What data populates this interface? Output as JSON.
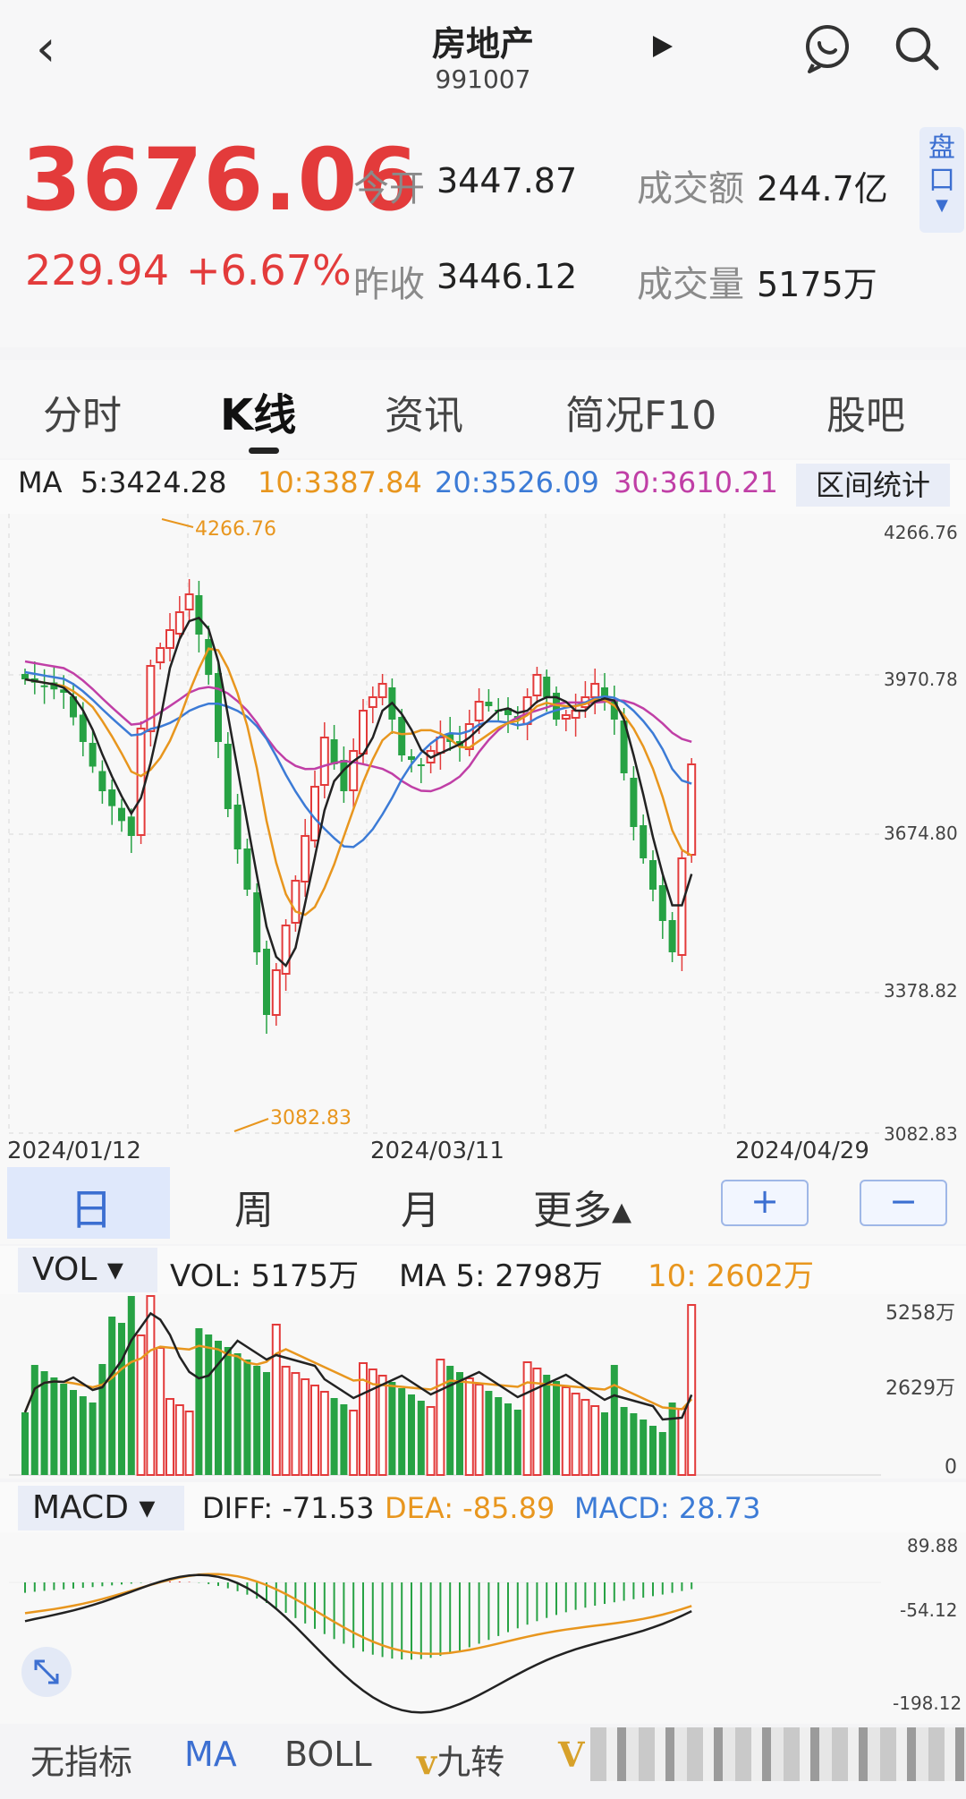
{
  "header": {
    "title": "房地产",
    "code": "991007"
  },
  "quote": {
    "price": "3676.06",
    "change": "229.94",
    "change_pct": "+6.67%",
    "open_label": "今开",
    "open": "3447.87",
    "prev_close_label": "昨收",
    "prev_close": "3446.12",
    "amount_label": "成交额",
    "amount": "244.7亿",
    "volume_label": "成交量",
    "volume": "5175万",
    "pankou": "盘口"
  },
  "tabs": [
    "分时",
    "K线",
    "资讯",
    "简况F10",
    "股吧"
  ],
  "ma_legend": {
    "prefix": "MA",
    "ma5": "5:3424.28",
    "ma10": "10:3387.84",
    "ma20": "20:3526.09",
    "ma30": "30:3610.21",
    "range_button": "区间统计"
  },
  "kline": {
    "axis": [
      "4266.76",
      "3970.78",
      "3674.80",
      "3378.82",
      "3082.83"
    ],
    "dates": [
      "2024/01/12",
      "2024/03/11",
      "2024/04/29"
    ],
    "high_marker": "4266.76",
    "low_marker": "3082.83"
  },
  "period": {
    "day": "日",
    "week": "周",
    "month": "月",
    "more": "更多▴",
    "zoom_in": "+",
    "zoom_out": "−"
  },
  "vol": {
    "selector": "VOL ▾",
    "vol": "VOL:  5175万",
    "ma5": "MA 5:  2798万",
    "ma10": "10:  2602万",
    "axis": [
      "5258万",
      "2629万",
      "0"
    ]
  },
  "macd": {
    "selector": "MACD ▾",
    "diff": "DIFF: -71.53",
    "dea": "DEA: -85.89",
    "macd": "MACD: 28.73",
    "axis": [
      "89.88",
      "-54.12",
      "-198.12"
    ]
  },
  "bottom_tabs": [
    "无指标",
    "MA",
    "BOLL",
    "九转",
    "V"
  ],
  "colors": {
    "up": "#e33b3b",
    "down": "#27a244",
    "ma5": "#222222",
    "ma10": "#e8961e",
    "ma20": "#3c7bd6",
    "ma30": "#c03fa6",
    "accent": "#3c6fd1"
  }
}
